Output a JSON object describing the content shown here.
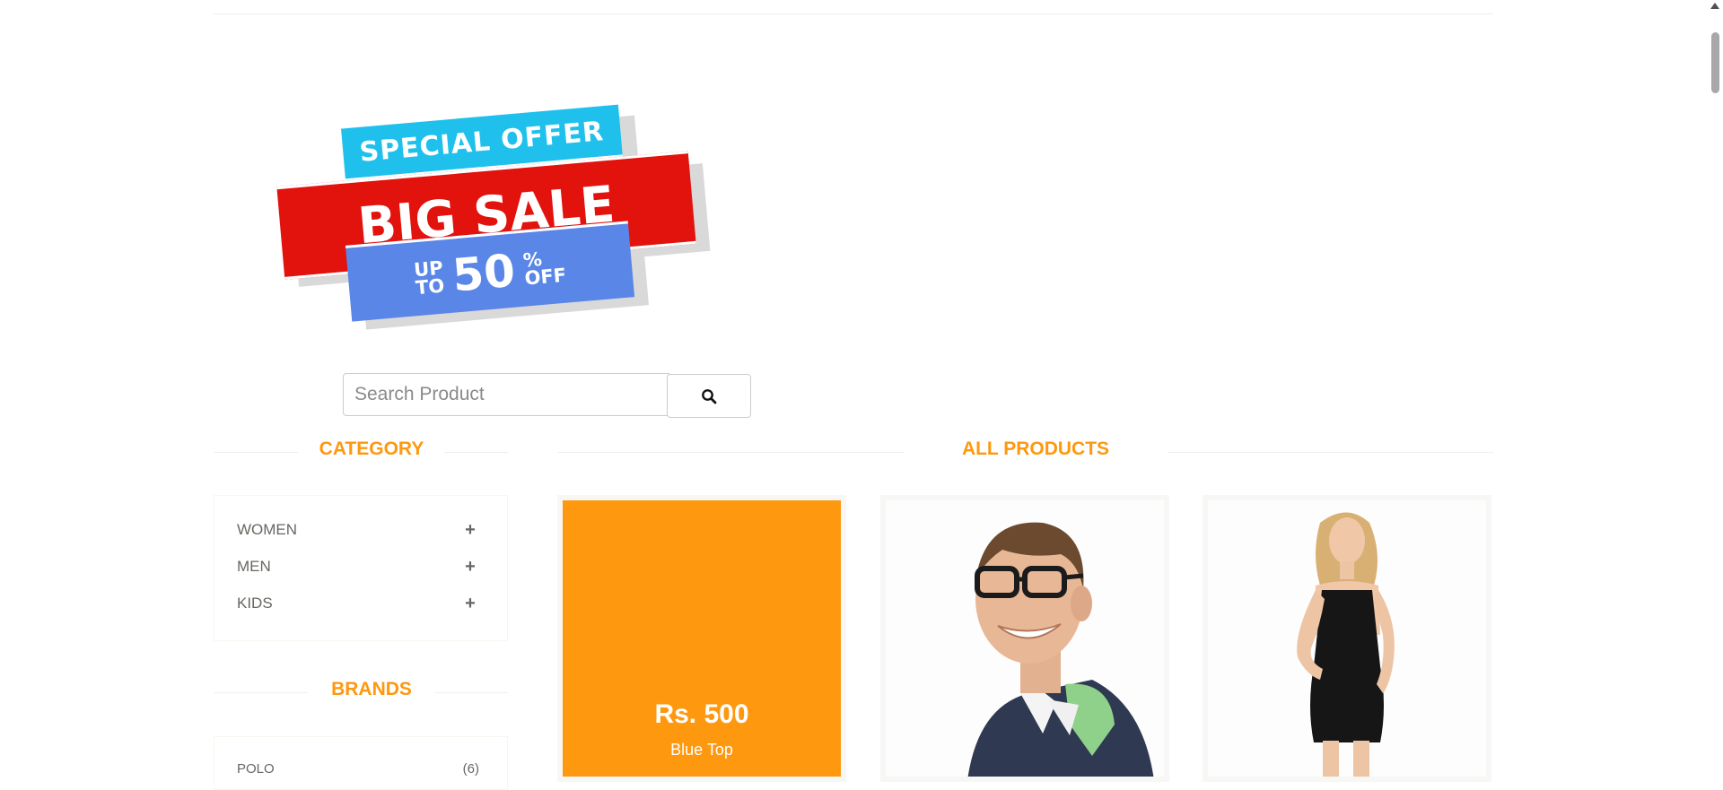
{
  "banner": {
    "line1": "SPECIAL OFFER",
    "line2": "BIG SALE",
    "up": "UP",
    "to": "TO",
    "amount": "50",
    "percent": "%",
    "off": "OFF"
  },
  "search": {
    "placeholder": "Search Product",
    "icon": "search-icon"
  },
  "sidebar": {
    "category_title": "CATEGORY",
    "categories": [
      {
        "label": "WOMEN",
        "icon": "plus-icon"
      },
      {
        "label": "MEN",
        "icon": "plus-icon"
      },
      {
        "label": "KIDS",
        "icon": "plus-icon"
      }
    ],
    "brands_title": "BRANDS",
    "brands": [
      {
        "label": "POLO",
        "count": "(6)"
      }
    ]
  },
  "main": {
    "title": "ALL PRODUCTS",
    "products": [
      {
        "price": "Rs. 500",
        "name": "Blue Top",
        "state": "hover-overlay"
      },
      {
        "image": "man-with-glasses-polo-shirt"
      },
      {
        "image": "woman-in-black-dress"
      }
    ]
  },
  "colors": {
    "accent": "#fe980f",
    "text": "#696763"
  }
}
